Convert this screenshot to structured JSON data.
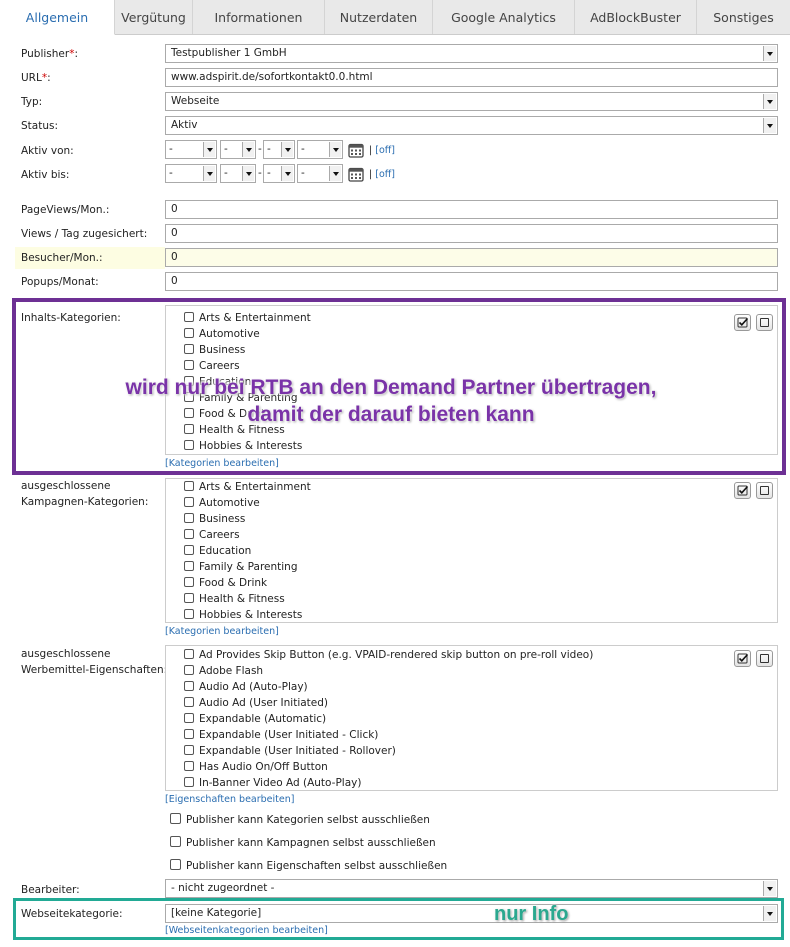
{
  "tabs": [
    "Allgemein",
    "Vergütung",
    "Informationen",
    "Nutzerdaten",
    "Google Analytics",
    "AdBlockBuster",
    "Sonstiges"
  ],
  "active_tab": "Allgemein",
  "form": {
    "publisher": {
      "label": "Publisher",
      "req": "*",
      "colon": ":",
      "value": "Testpublisher 1 GmbH"
    },
    "url": {
      "label": "URL",
      "req": "*",
      "colon": ":",
      "value": "www.adspirit.de/sofortkontakt0.0.html"
    },
    "typ": {
      "label": "Typ:",
      "value": "Webseite"
    },
    "status": {
      "label": "Status:",
      "value": "Aktiv"
    },
    "aktiv_von": {
      "label": "Aktiv von:",
      "placeholder": "-",
      "off": "[off]"
    },
    "aktiv_bis": {
      "label": "Aktiv bis:",
      "placeholder": "-",
      "off": "[off]"
    },
    "pageviews": {
      "label": "PageViews/Mon.:",
      "value": "0"
    },
    "views_tag": {
      "label": "Views / Tag zugesichert:",
      "value": "0"
    },
    "besucher": {
      "label": "Besucher/Mon.:",
      "value": "0"
    },
    "popups": {
      "label": "Popups/Monat:",
      "value": "0"
    }
  },
  "inhalts": {
    "label": "Inhalts-Kategorien:",
    "items": [
      "Arts & Entertainment",
      "Automotive",
      "Business",
      "Careers",
      "Education",
      "Family & Parenting",
      "Food & Drink",
      "Health & Fitness",
      "Hobbies & Interests"
    ],
    "edit_link": "[Kategorien bearbeiten]"
  },
  "kampagnen": {
    "label_1": "ausgeschlossene",
    "label_2": "Kampagnen-Kategorien:",
    "items": [
      "Arts & Entertainment",
      "Automotive",
      "Business",
      "Careers",
      "Education",
      "Family & Parenting",
      "Food & Drink",
      "Health & Fitness",
      "Hobbies & Interests"
    ],
    "edit_link": "[Kategorien bearbeiten]"
  },
  "werbemittel": {
    "label_1": "ausgeschlossene",
    "label_2": "Werbemittel-Eigenschaften:",
    "items": [
      "Ad Provides Skip Button (e.g. VPAID-rendered skip button on pre-roll video)",
      "Adobe Flash",
      "Audio Ad (Auto-Play)",
      "Audio Ad (User Initiated)",
      "Expandable (Automatic)",
      "Expandable (User Initiated - Click)",
      "Expandable (User Initiated - Rollover)",
      "Has Audio On/Off Button",
      "In-Banner Video Ad (Auto-Play)"
    ],
    "edit_link": "[Eigenschaften bearbeiten]"
  },
  "publisher_options": [
    "Publisher kann Kategorien selbst ausschließen",
    "Publisher kann Kampagnen selbst ausschließen",
    "Publisher kann Eigenschaften selbst ausschließen"
  ],
  "bearbeiter": {
    "label": "Bearbeiter:",
    "value": "- nicht zugeordnet -"
  },
  "webseitekategorie": {
    "label": "Webseitekategorie:",
    "value": "[keine Kategorie]",
    "edit_link": "[Webseitenkategorien bearbeiten]"
  },
  "annotations": {
    "purple_line1": "wird nur bei RTB an den Demand Partner übertragen,",
    "purple_line2": "damit der darauf bieten kann",
    "teal": "nur Info",
    "purple_color": "#6d3094",
    "teal_color": "#22aa95"
  }
}
